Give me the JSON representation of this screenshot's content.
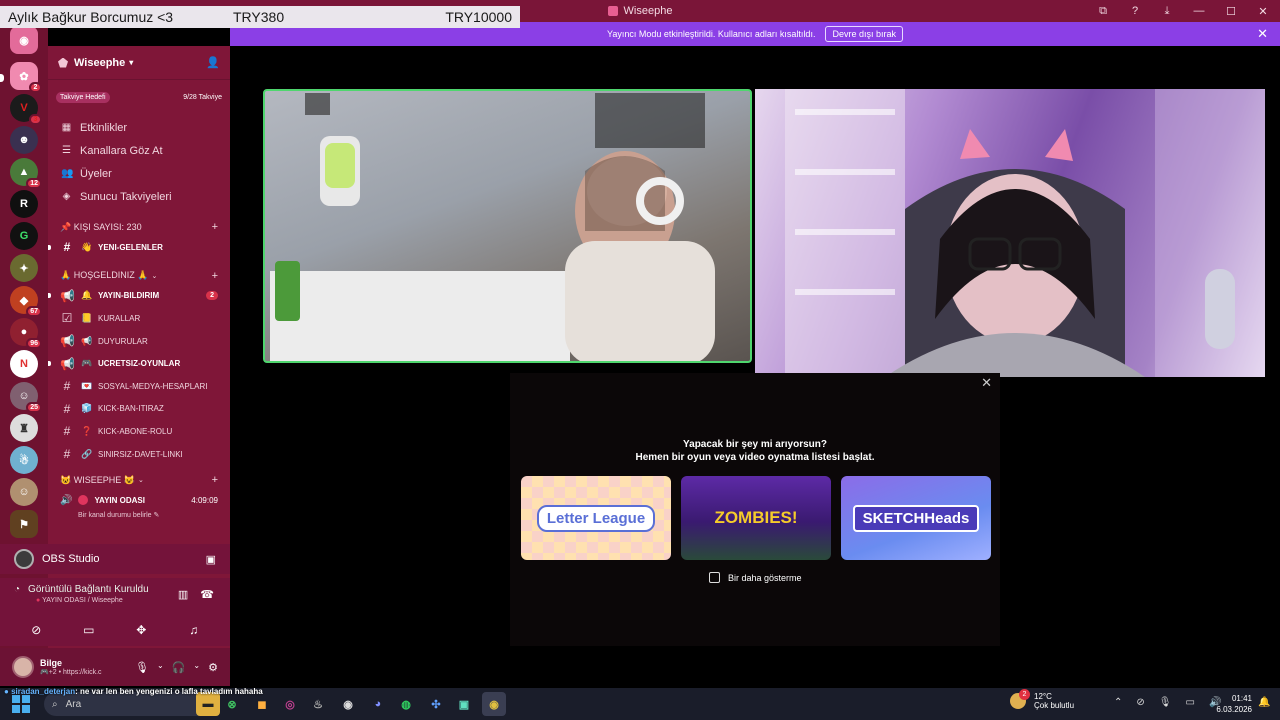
{
  "window": {
    "title": "Wiseephe"
  },
  "overlay": {
    "label": "Aylık Bağkur Borcumuz <3",
    "current": "TRY380",
    "goal": "TRY10000"
  },
  "banner": {
    "text": "Yayıncı Modu etkinleştirildi. Kullanıcı adları kısaltıldı.",
    "button": "Devre dışı bırak"
  },
  "rail": {
    "servers": [
      {
        "icon": "discord-home-icon",
        "badge": ""
      },
      {
        "icon": "server-pink-icon",
        "badge": "2"
      },
      {
        "icon": "server-v-icon",
        "badge": "3"
      },
      {
        "icon": "server-avatar-icon",
        "badge": ""
      },
      {
        "icon": "server-landscape-icon",
        "badge": "12"
      },
      {
        "icon": "server-r-icon",
        "badge": ""
      },
      {
        "icon": "server-g-icon",
        "badge": ""
      },
      {
        "icon": "server-map-icon",
        "badge": ""
      },
      {
        "icon": "server-fox-icon",
        "badge": "67"
      },
      {
        "icon": "server-red-icon",
        "badge": "96"
      },
      {
        "icon": "server-n-icon",
        "badge": ""
      },
      {
        "icon": "server-girl-icon",
        "badge": "25"
      },
      {
        "icon": "server-tower-icon",
        "badge": ""
      },
      {
        "icon": "server-rick-icon",
        "badge": ""
      },
      {
        "icon": "server-blonde-icon",
        "badge": ""
      },
      {
        "icon": "server-game-icon",
        "badge": ""
      }
    ]
  },
  "sidebar": {
    "server_name": "Wiseephe",
    "boost": {
      "label": "Takviye Hedefi",
      "progress": "9/28 Takviye"
    },
    "menu": [
      {
        "icon": "calendar-icon",
        "label": "Etkinlikler"
      },
      {
        "icon": "browse-icon",
        "label": "Kanallara Göz At"
      },
      {
        "icon": "members-icon",
        "label": "Üyeler"
      },
      {
        "icon": "boost-icon",
        "label": "Sunucu Takviyeleri"
      }
    ],
    "categories": {
      "kisi": "📌 KIŞI SAYISI: 230",
      "hos": "🙏 HOŞGELDINIZ 🙏",
      "wise": "😺 WISEEPHE 😺"
    },
    "channels_kisi": [
      {
        "type": "#",
        "emoji": "👋",
        "name": "YENI-GELENLER",
        "bold": true,
        "count": ""
      }
    ],
    "channels_hos": [
      {
        "type": "📢",
        "emoji": "🔔",
        "name": "YAYIN-BILDIRIM",
        "bold": true,
        "count": "2"
      },
      {
        "type": "☑",
        "emoji": "📒",
        "name": "KURALLAR",
        "bold": false,
        "count": ""
      },
      {
        "type": "📢",
        "emoji": "📢",
        "name": "DUYURULAR",
        "bold": false,
        "count": ""
      },
      {
        "type": "📢",
        "emoji": "🎮",
        "name": "UCRETSIZ-OYUNLAR",
        "bold": true,
        "count": ""
      },
      {
        "type": "#",
        "emoji": "💌",
        "name": "SOSYAL-MEDYA-HESAPLARI",
        "bold": false,
        "count": ""
      },
      {
        "type": "#",
        "emoji": "🧊",
        "name": "KICK-BAN-ITIRAZ",
        "bold": false,
        "count": ""
      },
      {
        "type": "#",
        "emoji": "❓",
        "name": "KICK-ABONE-ROLU",
        "bold": false,
        "count": ""
      },
      {
        "type": "#",
        "emoji": "🔗",
        "name": "SINIRSIZ-DAVET-LINKI",
        "bold": false,
        "count": ""
      }
    ],
    "voice": {
      "name": "YAYIN ODASI",
      "time": "4:09:09",
      "status": "Bir kanal durumu belirle"
    }
  },
  "obs": {
    "label": "OBS Studio"
  },
  "connection": {
    "title": "Görüntülü Bağlantı Kuruldu",
    "sub": "YAYIN ODASI / Wiseephe"
  },
  "user": {
    "name": "Bilge",
    "status": "🎮+2 • https://kick.c"
  },
  "modal": {
    "line1": "Yapacak bir şey mi arıyorsun?",
    "line2": "Hemen bir oyun veya video oynatma listesi başlat.",
    "games": [
      "Letter League",
      "ZOMBIES!",
      "SKETCHHeads"
    ],
    "checkbox": "Bir daha gösterme"
  },
  "ticker": {
    "user": "siradan_deterjan",
    "text": ": ne var len ben yengenizi o lafla tavladım hahaha"
  },
  "taskbar": {
    "search": "Ara",
    "weather_temp": "12°C",
    "weather_desc": "Çok bulutlu",
    "weather_badge": "2",
    "time": "01:41",
    "date": "6.03.2026"
  },
  "colors": {
    "accent": "#8b3fe6",
    "sidebar": "#7f1638",
    "rail": "#6e1230",
    "speaking": "#4fd66e"
  }
}
